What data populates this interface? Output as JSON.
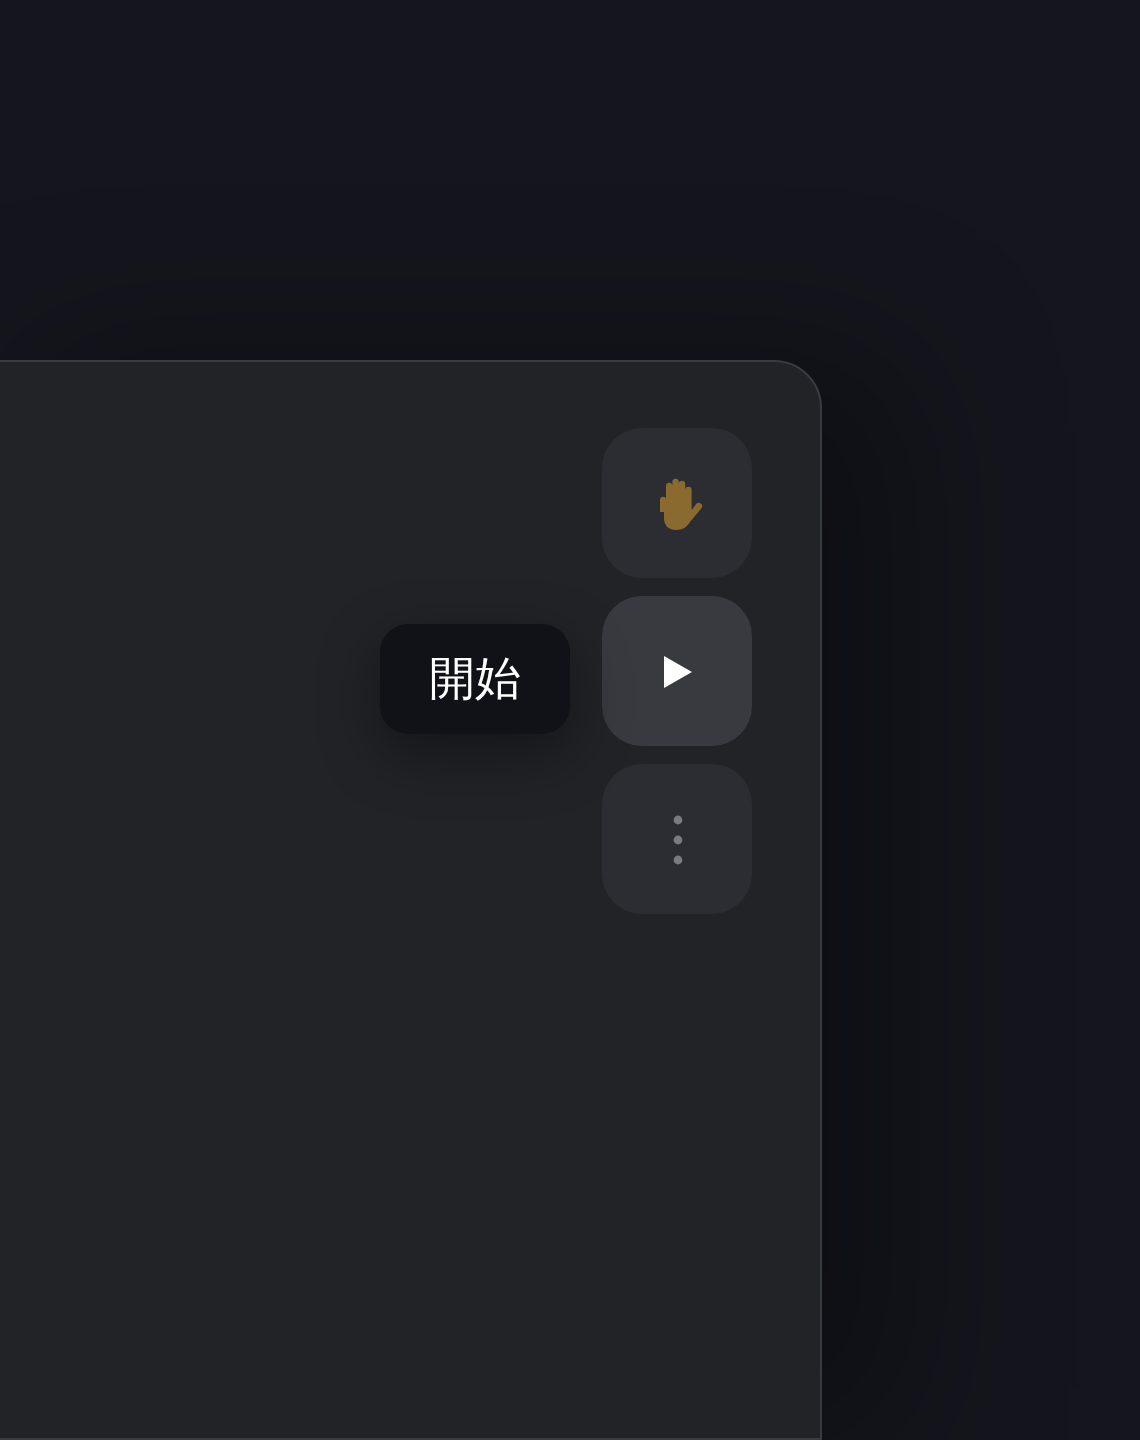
{
  "toolbar": {
    "buttons": [
      {
        "kind": "raise-hand",
        "highlighted": false
      },
      {
        "kind": "start",
        "highlighted": true
      },
      {
        "kind": "more",
        "highlighted": false
      }
    ]
  },
  "tooltip": {
    "text": "開始"
  }
}
